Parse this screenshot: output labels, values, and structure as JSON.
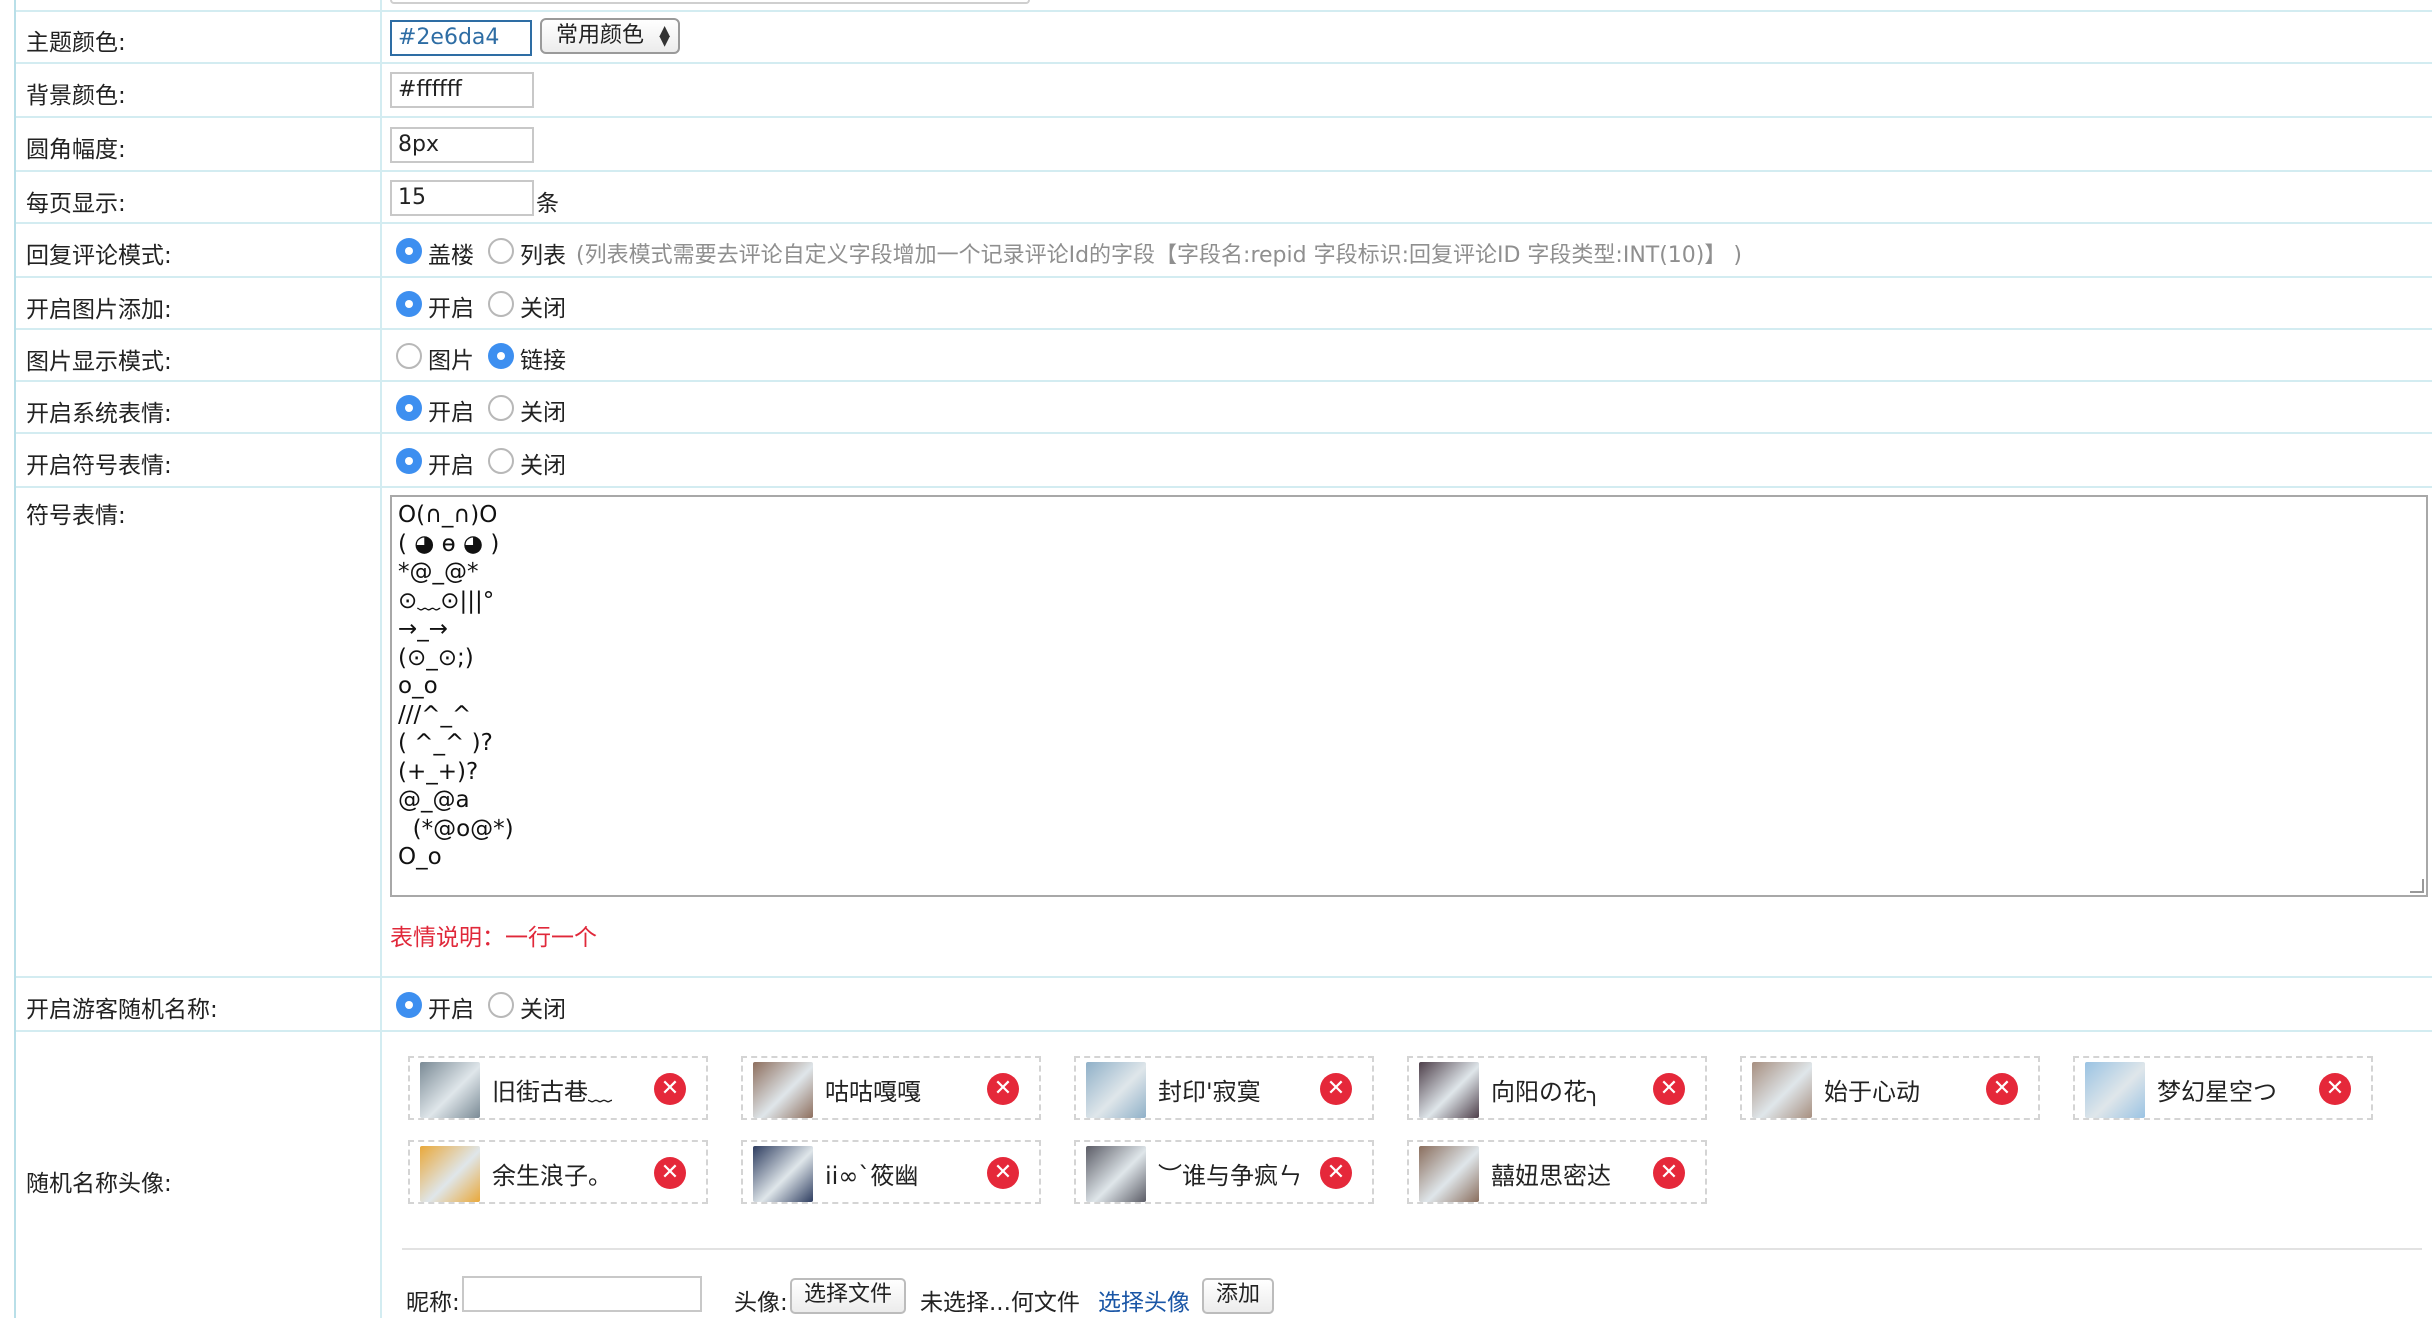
{
  "fields": {
    "theme_color": {
      "label": "主题颜色:",
      "value": "#2e6da4",
      "select": "常用颜色"
    },
    "bg_color": {
      "label": "背景颜色:",
      "value": "#ffffff"
    },
    "radius": {
      "label": "圆角幅度:",
      "value": "8px"
    },
    "per_page": {
      "label": "每页显示:",
      "value": "15",
      "unit": "条"
    },
    "reply_mode": {
      "label": "回复评论模式:",
      "option_a": "盖楼",
      "option_b": "列表",
      "hint": "(列表模式需要去评论自定义字段增加一个记录评论Id的字段【字段名:repid 字段标识:回复评论ID 字段类型:INT(10)】 )"
    },
    "image_add": {
      "label": "开启图片添加:",
      "option_a": "开启",
      "option_b": "关闭"
    },
    "image_mode": {
      "label": "图片显示模式:",
      "option_a": "图片",
      "option_b": "链接"
    },
    "system_emoji": {
      "label": "开启系统表情:",
      "option_a": "开启",
      "option_b": "关闭"
    },
    "symbol_emoji_toggle": {
      "label": "开启符号表情:",
      "option_a": "开启",
      "option_b": "关闭"
    },
    "symbol_emoji": {
      "label": "符号表情:",
      "lines": [
        "O(∩_∩)O",
        "( ◕ ө ◕ )",
        "*@_@*",
        "⊙﹏⊙|||°",
        "→_→",
        "(⊙_⊙;)",
        "o_o",
        "///^_^",
        "( ^_^ )?",
        "(+_+)?",
        "@_@a",
        "  (*@o@*)",
        "O_o"
      ],
      "note": "表情说明：一行一个"
    },
    "guest_name": {
      "label": "开启游客随机名称:",
      "option_a": "开启",
      "option_b": "关闭"
    },
    "avatars": {
      "label": "随机名称头像:",
      "items": [
        {
          "name": "旧街古巷﹏",
          "color": "#7a8a95"
        },
        {
          "name": "咕咕嘎嘎",
          "color": "#8e6f5e"
        },
        {
          "name": "封印'寂寞",
          "color": "#8fb0c8"
        },
        {
          "name": "向阳の花╮",
          "color": "#4e3f4a"
        },
        {
          "name": "始于心动",
          "color": "#a78f80"
        },
        {
          "name": "梦幻星空つ",
          "color": "#9ac3e3"
        },
        {
          "name": "余生浪子。",
          "color": "#e9a83a"
        },
        {
          "name": "ii∞`筱幽",
          "color": "#2e3d60"
        },
        {
          "name": "︶谁与争疯ㄣ",
          "color": "#5b5c66"
        },
        {
          "name": "囍妞思密达",
          "color": "#8a6e5d"
        }
      ],
      "delete_symbol": "✕"
    },
    "add_form": {
      "nickname_label": "昵称:",
      "nickname_value": "",
      "avatar_label": "头像:",
      "file_button": "选择文件",
      "file_status": "未选择...何文件",
      "pick_avatar": "选择头像",
      "add_button": "添加"
    }
  }
}
